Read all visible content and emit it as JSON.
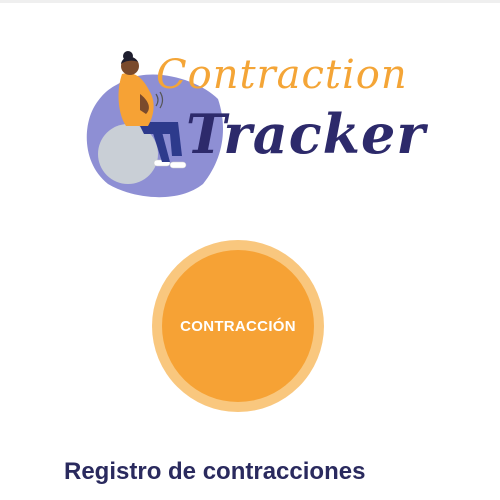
{
  "logo": {
    "word1": "Contraction",
    "word2": "Tracker"
  },
  "contraction_button": {
    "label": "CONTRACCIÓN"
  },
  "section": {
    "title": "Registro de contracciones"
  },
  "colors": {
    "accent_orange": "#f6a235",
    "accent_orange_light": "#f9c77e",
    "brand_navy": "#2d2a6b",
    "blob_purple": "#8e8fd4",
    "ball_gray": "#c9cfd6"
  }
}
